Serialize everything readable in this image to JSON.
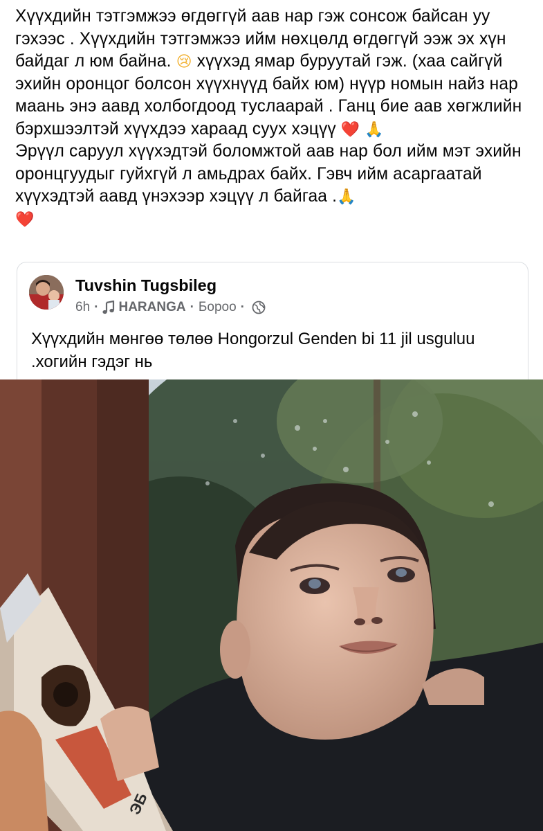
{
  "post": {
    "text_line1": "Хүүхдийн тэтгэмжээ өгдөггүй аав нар гэж сонсож байсан уу гэхээс . Хүүхдийн тэтгэмжээ ийм нөхцөлд өгдөггүй ээж эх хүн байдаг л юм байна.",
    "crying_emoji": "😢",
    "text_line2": " хүүхэд ямар буруутай гэж. (хаа сайгүй эхийн оронцог болсон хүүхнүүд байх юм)  нүүр номын найз нар маань энэ аавд холбогдоод туслаарай . Ганц бие аав хөгжлийн бэрхшээлтэй хүүхдээ хараад суух хэцүү ",
    "heart_emoji": "❤️",
    "pray_emoji": "🙏",
    "text_line3": "Эрүүл саруул хүүхэдтэй боломжтой аав нар бол ийм мэт эхийн оронцгуудыг гуйхгүй л амьдрах байх. Гэвч ийм асаргаатай хүүхэдтэй аавд үнэхээр хэцүү л байгаа .",
    "pray_emoji_2": "🙏",
    "heart_emoji_2": "❤️"
  },
  "shared_post": {
    "author_name": "Tuvshin Tugsbileg",
    "time": "6h",
    "group_name": "HARANGA",
    "location": "Бороо",
    "text": "Хүүхдийн мөнгөө төлөө Hongorzul Genden bi 11 jil usguluu .хогийн гэдэг нь",
    "icons": [
      "music-note-icon",
      "globe-icon"
    ]
  },
  "colors": {
    "text": "#050505",
    "meta": "#65676b",
    "card_border": "#dadde1"
  }
}
